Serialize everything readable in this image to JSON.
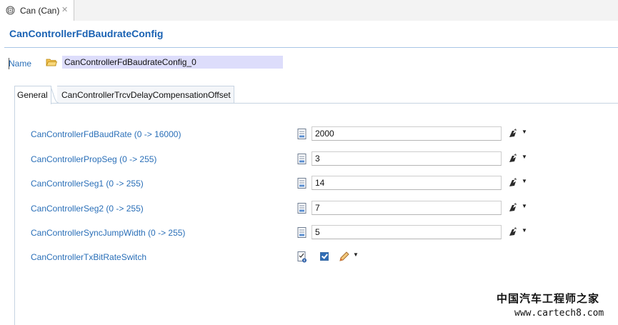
{
  "editor_tab": {
    "label": "Can (Can)",
    "close_glyph": "✕"
  },
  "header": {
    "title": "CanControllerFdBaudrateConfig"
  },
  "name_row": {
    "label": "Name",
    "value": "CanControllerFdBaudrateConfig_0"
  },
  "tabs": [
    {
      "label": "General",
      "selected": true
    },
    {
      "label": "CanControllerTrcvDelayCompensationOffset",
      "selected": false
    }
  ],
  "params": [
    {
      "label": "CanControllerFdBaudRate (0 -> 16000)",
      "value": "2000"
    },
    {
      "label": "CanControllerPropSeg (0 -> 255)",
      "value": "3"
    },
    {
      "label": "CanControllerSeg1 (0 -> 255)",
      "value": "14"
    },
    {
      "label": "CanControllerSeg2 (0 -> 255)",
      "value": "7"
    },
    {
      "label": "CanControllerSyncJumpWidth (0 -> 255)",
      "value": "5"
    }
  ],
  "switch_param": {
    "label": "CanControllerTxBitRateSwitch",
    "checked": true
  },
  "icons": {
    "editor_tab": "can-module-icon",
    "name": "folder-icon",
    "param": "parameter-doc-icon",
    "action": "action-menu-icon",
    "dropdown": "dropdown-caret-icon",
    "pencil": "pencil-icon"
  },
  "dropdown_glyph": "▼",
  "watermark": {
    "line1": "中国汽车工程师之家",
    "line2": "www.cartech8.com"
  },
  "colors": {
    "label_blue": "#2a6fb8",
    "title_blue": "#1a62b3",
    "name_field_bg": "#ddddfb"
  }
}
